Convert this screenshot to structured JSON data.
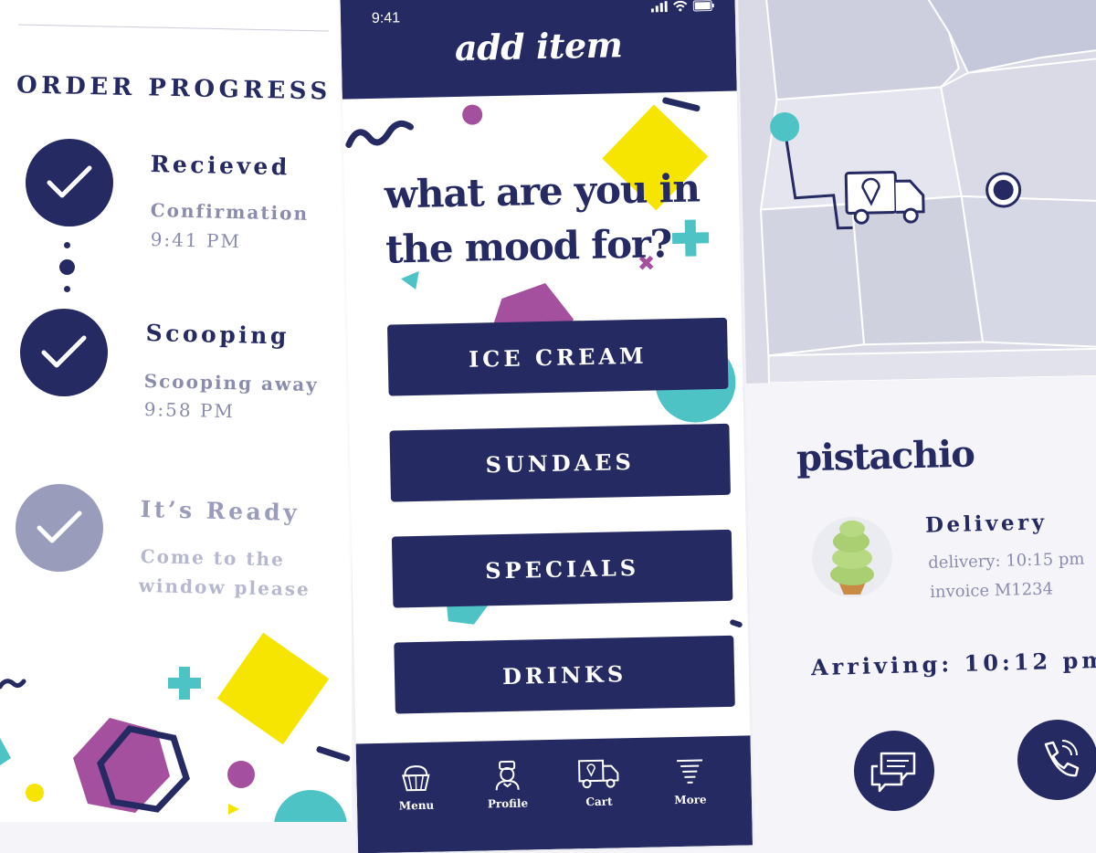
{
  "left": {
    "title": "ORDER PROGRESS",
    "steps": [
      {
        "title": "Recieved",
        "subtitle": "Confirmation",
        "time": "9:41 PM",
        "state": "done"
      },
      {
        "title": "Scooping",
        "subtitle": "Scooping away",
        "time": "9:58 PM",
        "state": "done"
      },
      {
        "title": "It’s Ready",
        "subtitle_line1": "Come to the",
        "subtitle_line2": "window please",
        "state": "pending"
      }
    ]
  },
  "phone": {
    "status_time": "9:41",
    "header_title": "add item",
    "heading_line1": "what are you in",
    "heading_line2": "the mood for?",
    "categories": [
      "ICE CREAM",
      "SUNDAES",
      "SPECIALS",
      "DRINKS"
    ],
    "nav": [
      {
        "label": "Menu",
        "icon": "ice-cream-cup-icon"
      },
      {
        "label": "Profile",
        "icon": "profile-icon"
      },
      {
        "label": "Cart",
        "icon": "truck-icon"
      },
      {
        "label": "More",
        "icon": "more-icon"
      }
    ]
  },
  "right": {
    "flavor": "pistachio",
    "delivery_title": "Delivery",
    "delivery_time": "delivery: 10:15 pm",
    "invoice": "invoice M1234",
    "arriving": "Arriving: 10:12 pm"
  },
  "colors": {
    "navy": "#262a63",
    "teal": "#4dc3c6",
    "purple": "#a5509e",
    "yellow": "#f5e500",
    "muted": "#9a9cbc",
    "map_bg": "#d9dae6"
  }
}
